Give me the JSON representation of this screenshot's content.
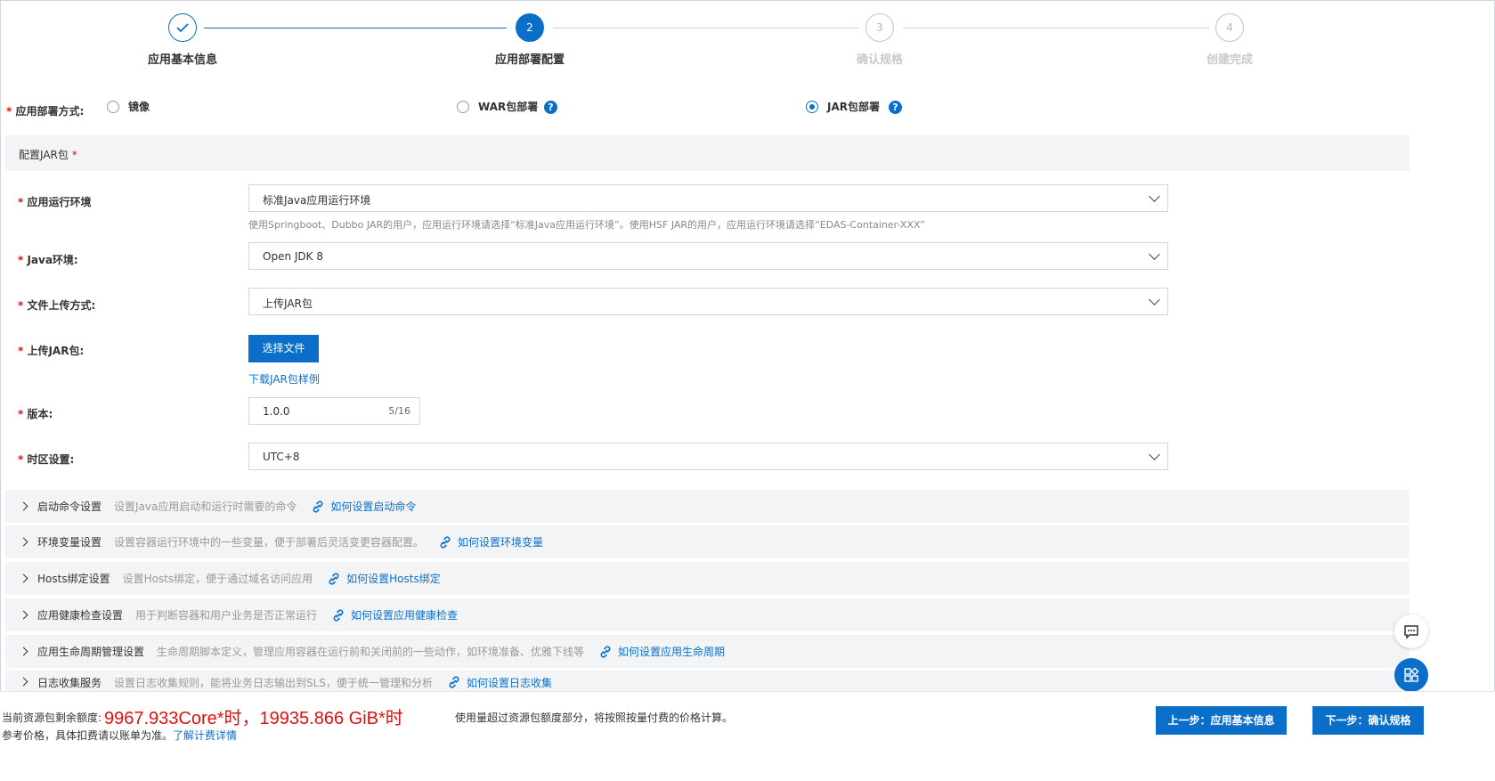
{
  "steps": [
    {
      "num": "",
      "label": "应用基本信息",
      "state": "done"
    },
    {
      "num": "2",
      "label": "应用部署配置",
      "state": "active"
    },
    {
      "num": "3",
      "label": "确认规格",
      "state": "todo"
    },
    {
      "num": "4",
      "label": "创建完成",
      "state": "todo"
    }
  ],
  "deploy_method": {
    "label": "应用部署方式:",
    "options": [
      "镜像",
      "WAR包部署",
      "JAR包部署"
    ],
    "selected": "JAR包部署",
    "help_icon": "?"
  },
  "section": {
    "title": "配置JAR包"
  },
  "form": {
    "runtime": {
      "label": "应用运行环境",
      "value": "标准Java应用运行环境",
      "help": "使用Springboot、Dubbo JAR的用户，应用运行环境请选择“标准Java应用运行环境”。使用HSF JAR的用户，应用运行环境请选择“EDAS-Container-XXX”"
    },
    "java": {
      "label": "Java环境:",
      "value": "Open JDK 8"
    },
    "upload_method": {
      "label": "文件上传方式:",
      "value": "上传JAR包"
    },
    "upload": {
      "label": "上传JAR包:",
      "button": "选择文件",
      "sample_link": "下载JAR包样例"
    },
    "version": {
      "label": "版本:",
      "value": "1.0.0",
      "count": "5/16"
    },
    "timezone": {
      "label": "时区设置:",
      "value": "UTC+8"
    }
  },
  "rows": [
    {
      "title": "启动命令设置",
      "desc": "设置Java应用启动和运行时需要的命令",
      "link": "如何设置启动命令"
    },
    {
      "title": "环境变量设置",
      "desc": "设置容器运行环境中的一些变量，便于部署后灵活变更容器配置。",
      "link": "如何设置环境变量"
    },
    {
      "title": "Hosts绑定设置",
      "desc": "设置Hosts绑定，便于通过域名访问应用",
      "link": "如何设置Hosts绑定"
    },
    {
      "title": "应用健康检查设置",
      "desc": "用于判断容器和用户业务是否正常运行",
      "link": "如何设置应用健康检查"
    },
    {
      "title": "应用生命周期管理设置",
      "desc": "生命周期脚本定义，管理应用容器在运行前和关闭前的一些动作，如环境准备、优雅下线等",
      "link": "如何设置应用生命周期"
    },
    {
      "title": "日志收集服务",
      "desc": "设置日志收集规则，能将业务日志输出到SLS，便于统一管理和分析",
      "link": "如何设置日志收集"
    }
  ],
  "footer": {
    "quota_label": "当前资源包剩余额度:",
    "quota_value": "9967.933Core*时，19935.866 GiB*时",
    "quota_note": "使用量超过资源包额度部分，将按照按量付费的价格计算。",
    "ref_text": "参考价格，具体扣费请以账单为准。",
    "ref_link": "了解计费详情",
    "prev_button": "上一步：应用基本信息",
    "next_button": "下一步：确认规格"
  },
  "colors": {
    "primary": "#0b6fca",
    "required": "#e01010",
    "panel": "#f3f4f6"
  },
  "icons": {
    "step_done": "check-icon",
    "row": "chevron-right-icon",
    "link": "link-icon",
    "float1": "chat-icon",
    "float2": "apps-icon"
  }
}
